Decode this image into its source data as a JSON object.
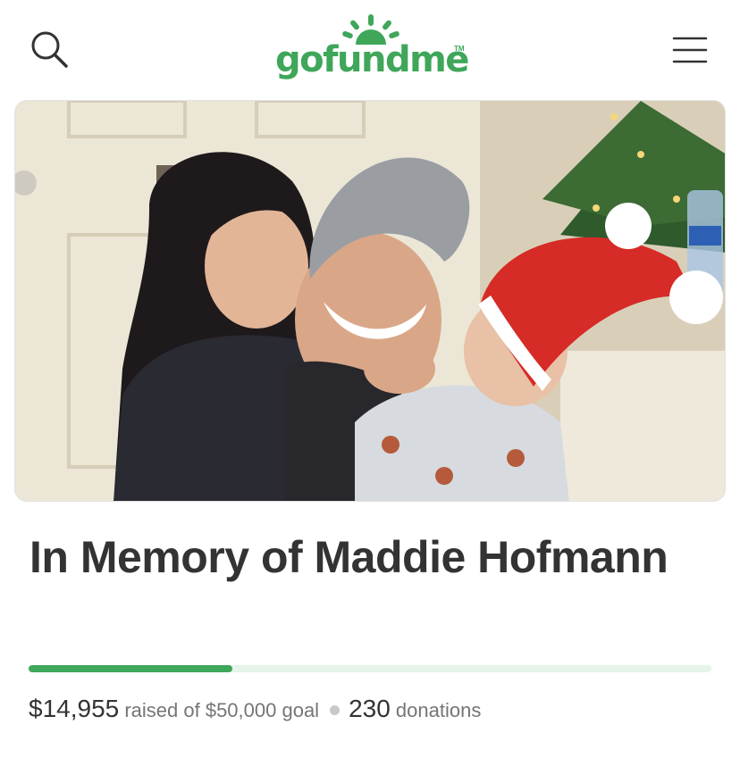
{
  "header": {
    "logo_text": "gofundme",
    "logo_tm": "TM",
    "icons": {
      "search": "search-icon",
      "menu": "hamburger-menu-icon",
      "logo_mark": "sun-rays-icon"
    }
  },
  "campaign": {
    "image_alt": "campaign photo",
    "title": "In Memory of Maddie Hofmann",
    "raised": "$14,955",
    "raised_text": "raised of $50,000 goal",
    "donations_count": "230",
    "donations_label": "donations",
    "progress_fraction": 0.299
  },
  "colors": {
    "brand": "#3fa65a",
    "track": "#e6f4ea",
    "text": "#333333",
    "muted": "#757575"
  }
}
